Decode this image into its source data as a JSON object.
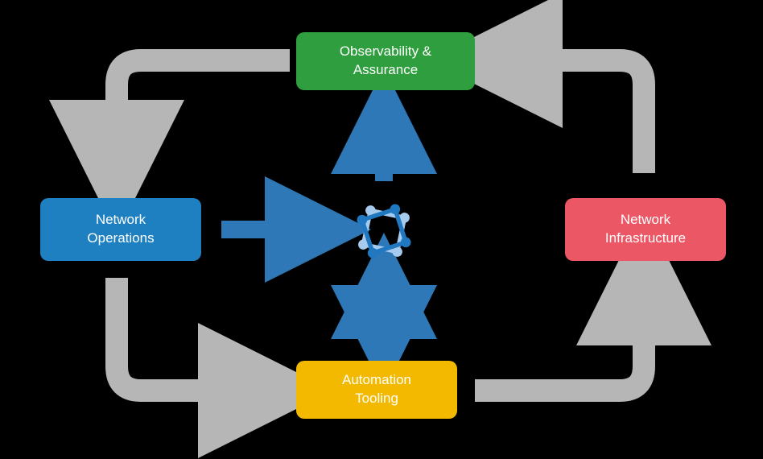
{
  "diagram": {
    "nodes": {
      "observability": {
        "label": "Observability &\nAssurance"
      },
      "operations": {
        "label": "Network\nOperations"
      },
      "automation": {
        "label": "Automation\nTooling"
      },
      "infrastructure": {
        "label": "Network\nInfrastructure"
      }
    },
    "center": {
      "name": "source-of-truth-icon"
    },
    "arrows": [
      {
        "from": "observability",
        "to": "operations",
        "style": "outer-gray"
      },
      {
        "from": "operations",
        "to": "automation",
        "style": "outer-gray"
      },
      {
        "from": "automation",
        "to": "infrastructure",
        "style": "outer-gray"
      },
      {
        "from": "infrastructure",
        "to": "observability",
        "style": "outer-gray"
      },
      {
        "from": "operations",
        "to": "center",
        "style": "inner-blue"
      },
      {
        "from": "center",
        "to": "observability",
        "style": "inner-blue"
      },
      {
        "from": "center",
        "to": "automation",
        "style": "inner-blue-bidir"
      }
    ],
    "colors": {
      "gray_arrow": "#B6B6B6",
      "blue_arrow": "#2E78B7",
      "center_light": "#A6CBEE",
      "center_dark": "#2078C0"
    }
  }
}
